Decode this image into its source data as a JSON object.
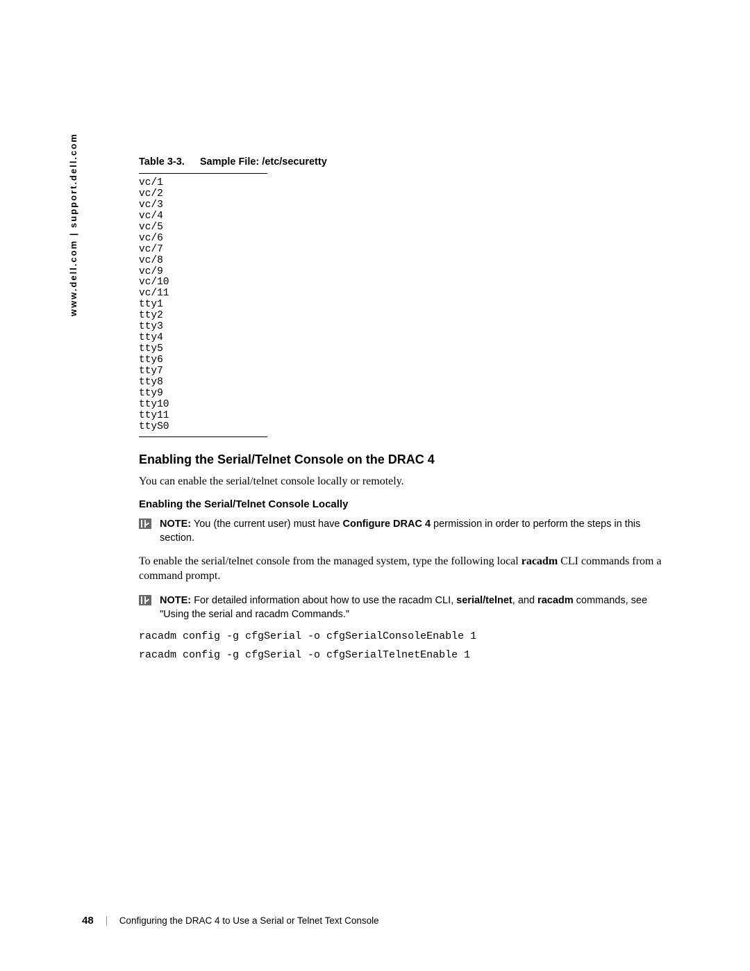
{
  "sidebar": {
    "url": "www.dell.com | support.dell.com"
  },
  "table": {
    "label": "Table 3-3.",
    "title": "Sample File: /etc/securetty",
    "lines": [
      "vc/1",
      "vc/2",
      "vc/3",
      "vc/4",
      "vc/5",
      "vc/6",
      "vc/7",
      "vc/8",
      "vc/9",
      "vc/10",
      "vc/11",
      "tty1",
      "tty2",
      "tty3",
      "tty4",
      "tty5",
      "tty6",
      "tty7",
      "tty8",
      "tty9",
      "tty10",
      "tty11",
      "ttyS0"
    ]
  },
  "section": {
    "heading": "Enabling the Serial/Telnet Console on the DRAC 4",
    "intro": "You can enable the serial/telnet console locally or remotely.",
    "sub_heading": "Enabling the Serial/Telnet Console Locally"
  },
  "note1": {
    "label": "NOTE:",
    "pre": " You (the current user) must have ",
    "bold": "Configure DRAC 4",
    "post": " permission in order to perform the steps in this section."
  },
  "body2": {
    "pre": "To enable the serial/telnet console from the managed system, type the following local ",
    "bold": "racadm",
    "post": " CLI commands from a command prompt."
  },
  "note2": {
    "label": "NOTE:",
    "pre": " For detailed information about how to use the ",
    "m1": "racadm",
    "mid1": " CLI, ",
    "bold1": "serial/telnet",
    "mid2": ", and ",
    "bold2": "racadm",
    "post": " commands, see \"Using the serial and racadm Commands.\""
  },
  "commands": {
    "c1": "racadm config -g cfgSerial -o cfgSerialConsoleEnable 1",
    "c2": "racadm config -g cfgSerial -o cfgSerialTelnetEnable 1"
  },
  "footer": {
    "page": "48",
    "chapter": "Configuring the DRAC 4 to Use a Serial or Telnet Text Console"
  }
}
